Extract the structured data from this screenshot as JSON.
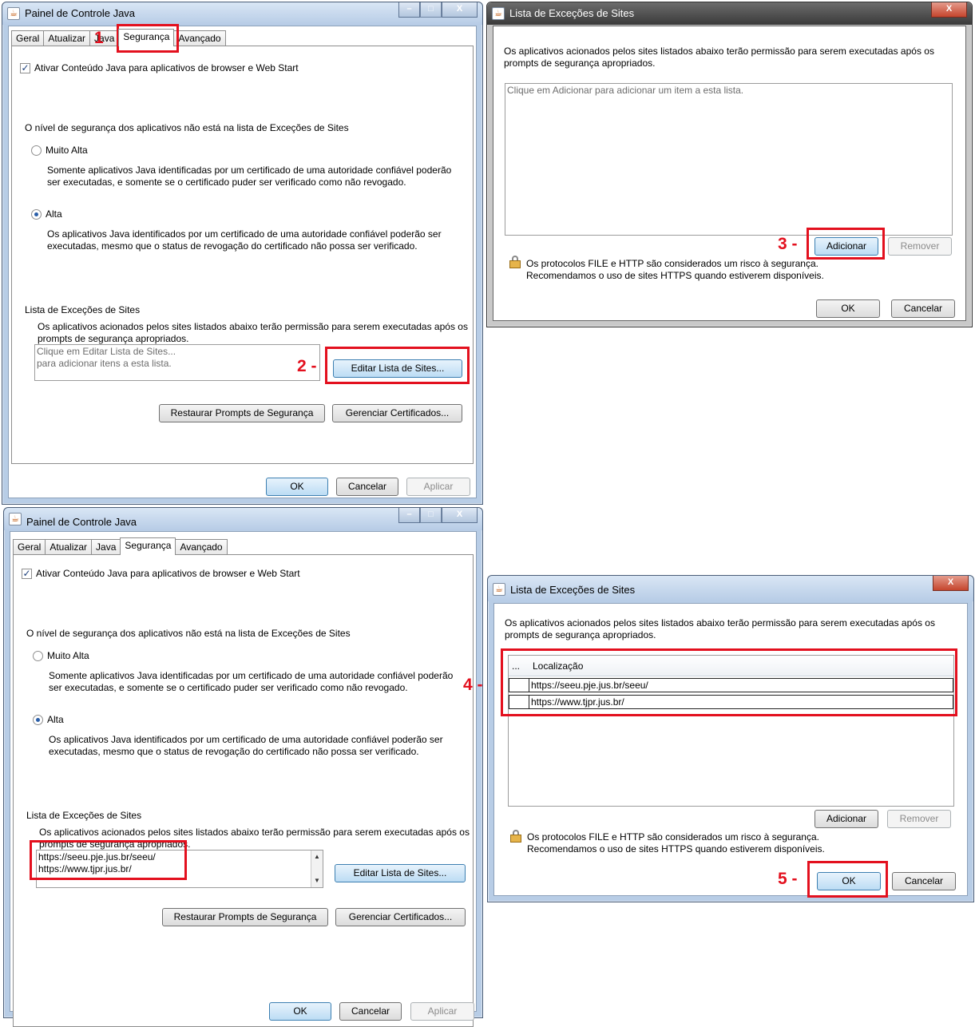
{
  "colors": {
    "highlight": "#e3101e",
    "window_frame": "#b8cde6"
  },
  "steps": {
    "s1": "1",
    "s2": "2 -",
    "s3": "3 -",
    "s4": "4 -",
    "s5": "5 -"
  },
  "java_panel": {
    "title": "Painel de Controle Java",
    "tabs": [
      "Geral",
      "Atualizar",
      "Java",
      "Segurança",
      "Avançado"
    ],
    "enable_java": "Ativar Conteúdo Java para aplicativos de browser e Web Start",
    "security_heading": "O nível de segurança dos aplicativos não está na lista de Exceções de Sites",
    "very_high": "Muito Alta",
    "very_high_desc_1": "Somente aplicativos Java identificadas por um certificado de uma autoridade confiável poderão",
    "very_high_desc_2": "ser executadas, e somente se o certificado puder ser verificado como não revogado.",
    "high": "Alta",
    "high_desc_1": "Os aplicativos Java identificados por um certificado de uma autoridade confiável poderão ser",
    "high_desc_2": "executadas, mesmo que o status de revogação do certificado não possa ser verificado.",
    "exceptions_heading": "Lista de Exceções de Sites",
    "exceptions_desc_1": "Os aplicativos acionados pelos sites listados abaixo terão permissão para serem executadas após os",
    "exceptions_desc_2": "prompts de segurança apropriados.",
    "list_placeholder_1": "Clique em Editar Lista de Sites...",
    "list_placeholder_2": "para adicionar itens a esta lista.",
    "list_items": [
      "https://seeu.pje.jus.br/seeu/",
      "https://www.tjpr.jus.br/"
    ],
    "edit_sites": "Editar Lista de Sites...",
    "restore_prompts": "Restaurar Prompts de Segurança",
    "manage_certs": "Gerenciar Certificados...",
    "ok": "OK",
    "cancel": "Cancelar",
    "apply": "Aplicar"
  },
  "exceptions_dialog": {
    "title": "Lista de Exceções de Sites",
    "desc_1": "Os aplicativos acionados pelos sites listados abaixo terão permissão para serem executadas após os",
    "desc_2": "prompts de segurança apropriados.",
    "empty_hint": "Clique em Adicionar para adicionar um item a esta lista.",
    "col_dots": "...",
    "col_location": "Localização",
    "rows": [
      "https://seeu.pje.jus.br/seeu/",
      "https://www.tjpr.jus.br/"
    ],
    "add": "Adicionar",
    "remove": "Remover",
    "warning_1": "Os protocolos FILE e HTTP são considerados um risco à segurança.",
    "warning_2": "Recomendamos o uso de sites HTTPS quando estiverem disponíveis.",
    "ok": "OK",
    "cancel": "Cancelar"
  }
}
